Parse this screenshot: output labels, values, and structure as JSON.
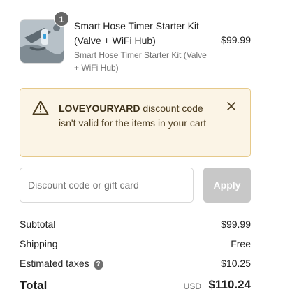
{
  "line_item": {
    "quantity": "1",
    "title": "Smart Hose Timer Starter Kit (Valve + WiFi Hub)",
    "variant": "Smart Hose Timer Starter Kit (Valve + WiFi Hub)",
    "price": "$99.99",
    "image_icon": "product-image"
  },
  "warning": {
    "code": "LOVEYOURYARD",
    "message": " discount code isn't valid for the items in your cart",
    "icon": "warning-triangle-icon",
    "close_icon": "close-icon",
    "colors": {
      "background": "#fbf4e6",
      "border": "#e6c98a"
    }
  },
  "discount": {
    "placeholder": "Discount code or gift card",
    "value": "",
    "apply_label": "Apply"
  },
  "summary": {
    "subtotal_label": "Subtotal",
    "subtotal_value": "$99.99",
    "shipping_label": "Shipping",
    "shipping_value": "Free",
    "taxes_label": "Estimated taxes",
    "taxes_help": "?",
    "taxes_value": "$10.25",
    "total_label": "Total",
    "total_currency": "USD",
    "total_value": "$110.24"
  }
}
